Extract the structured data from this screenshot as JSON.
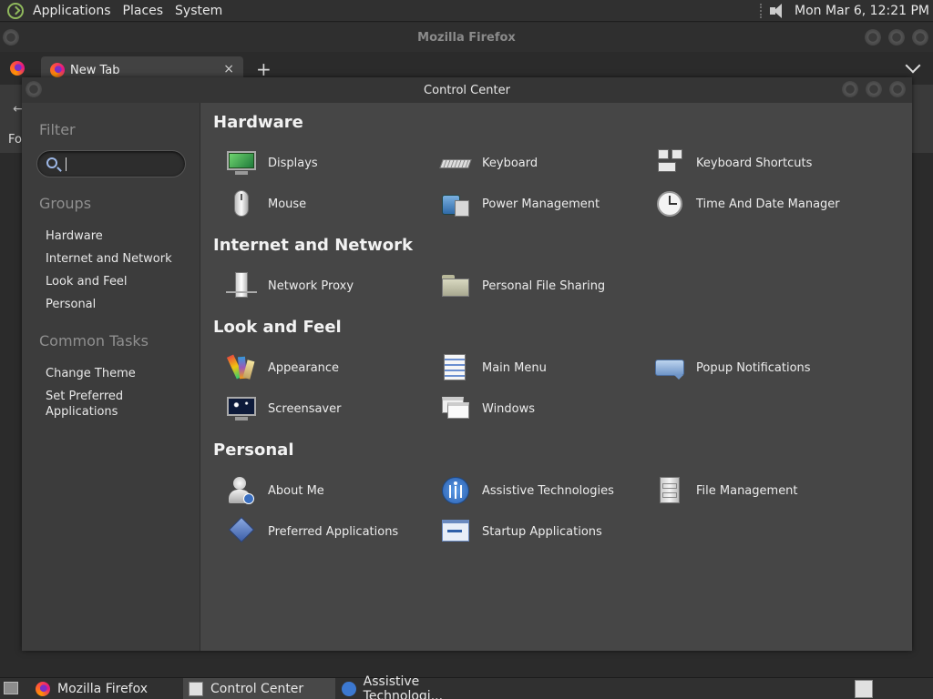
{
  "top_panel": {
    "menus": [
      "Applications",
      "Places",
      "System"
    ],
    "clock": "Mon Mar  6, 12:21 PM"
  },
  "firefox": {
    "title": "Mozilla Firefox",
    "tab_label": "New Tab",
    "tab_close": "×",
    "new_tab": "+",
    "side_text": "Fo",
    "back": "←"
  },
  "control_center": {
    "title": "Control Center",
    "sidebar": {
      "filter_heading": "Filter",
      "search_value": "",
      "groups_heading": "Groups",
      "groups": [
        "Hardware",
        "Internet and Network",
        "Look and Feel",
        "Personal"
      ],
      "tasks_heading": "Common Tasks",
      "tasks": [
        "Change Theme",
        "Set Preferred\nApplications"
      ]
    },
    "sections": [
      {
        "title": "Hardware",
        "items": [
          {
            "label": "Displays",
            "icon": "display-icon"
          },
          {
            "label": "Keyboard",
            "icon": "keyboard-icon"
          },
          {
            "label": "Keyboard Shortcuts",
            "icon": "keyboard-shortcuts-icon"
          },
          {
            "label": "Mouse",
            "icon": "mouse-icon"
          },
          {
            "label": "Power Management",
            "icon": "power-management-icon"
          },
          {
            "label": "Time And Date Manager",
            "icon": "clock-icon"
          }
        ]
      },
      {
        "title": "Internet and Network",
        "items": [
          {
            "label": "Network Proxy",
            "icon": "network-proxy-icon"
          },
          {
            "label": "Personal File Sharing",
            "icon": "folder-share-icon"
          }
        ]
      },
      {
        "title": "Look and Feel",
        "items": [
          {
            "label": "Appearance",
            "icon": "appearance-icon"
          },
          {
            "label": "Main Menu",
            "icon": "main-menu-icon"
          },
          {
            "label": "Popup Notifications",
            "icon": "notification-icon"
          },
          {
            "label": "Screensaver",
            "icon": "screensaver-icon"
          },
          {
            "label": "Windows",
            "icon": "windows-icon"
          }
        ]
      },
      {
        "title": "Personal",
        "items": [
          {
            "label": "About Me",
            "icon": "about-me-icon"
          },
          {
            "label": "Assistive Technologies",
            "icon": "accessibility-icon"
          },
          {
            "label": "File Management",
            "icon": "file-cabinet-icon"
          },
          {
            "label": "Preferred Applications",
            "icon": "preferred-apps-icon"
          },
          {
            "label": "Startup Applications",
            "icon": "startup-apps-icon"
          }
        ]
      }
    ]
  },
  "taskbar": {
    "tasks": [
      {
        "label": "Mozilla Firefox",
        "icon": "firefox-icon",
        "active": false
      },
      {
        "label": "Control Center",
        "icon": "control-center-icon",
        "active": true
      },
      {
        "label": "Assistive Technologi...",
        "icon": "accessibility-icon",
        "active": false
      }
    ]
  },
  "colors": {
    "panel_bg": "#303030",
    "window_bg": "#3c3c3c",
    "content_bg": "#464646",
    "accent_green": "#8fb85c"
  }
}
